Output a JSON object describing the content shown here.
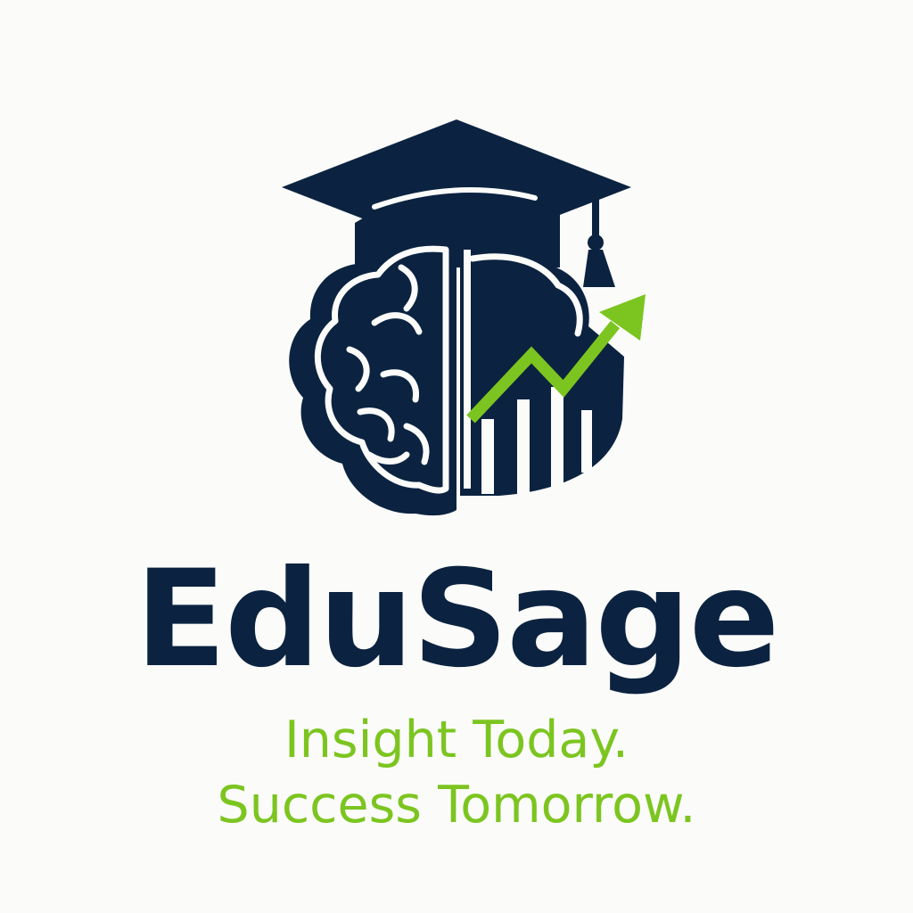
{
  "brand": {
    "name": "EduSage",
    "tagline_line1": "Insight Today.",
    "tagline_line2": "Success Tomorrow."
  },
  "logo": {
    "icons": [
      "graduation-cap-icon",
      "brain-icon",
      "growth-chart-icon",
      "trend-arrow-icon"
    ]
  },
  "colors": {
    "navy": "#0b2340",
    "green": "#7cc520",
    "background": "#fbfbfa"
  }
}
